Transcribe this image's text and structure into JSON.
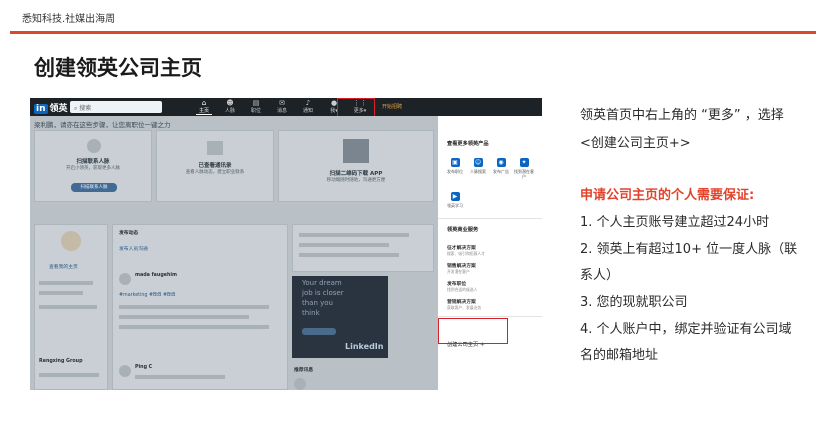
{
  "header": {
    "brand": "悉知科技.社媒出海周"
  },
  "slide": {
    "title": "创建领英公司主页"
  },
  "screenshot": {
    "topbar": {
      "logo": "领英",
      "search_placeholder": "搜索",
      "nav": [
        {
          "label": "主页",
          "icon": "home-icon",
          "glyph": "⌂"
        },
        {
          "label": "人脉",
          "icon": "people-icon",
          "glyph": "☻"
        },
        {
          "label": "职位",
          "icon": "briefcase-icon",
          "glyph": "▤"
        },
        {
          "label": "消息",
          "icon": "message-icon",
          "glyph": "✉"
        },
        {
          "label": "通知",
          "icon": "bell-icon",
          "glyph": "♪"
        },
        {
          "label": "我▾",
          "icon": "avatar-icon",
          "glyph": "●"
        },
        {
          "label": "更多▾",
          "icon": "grid-icon",
          "glyph": "⋮⋮"
        }
      ],
      "recruit": "开始招聘"
    },
    "feed": {
      "tagline": "梁利鹏，请亦在这些步骤，让您离职位一键之力",
      "card1": {
        "title": "扫描联系人脉",
        "sub": "开启小领英，获取更多人脉",
        "button": "扫描联系人脉"
      },
      "card2": {
        "title": "已查看通讯录",
        "sub": "查看人脉动态，建立职业联系"
      },
      "card3": {
        "title": "扫描二维码下载 APP",
        "sub": "移动端随时随地，沟通更方便"
      },
      "profile_link": "查看我的主页",
      "post_title": "发布动态",
      "post_sub": "发布人员沟通",
      "author1": "mada faugehim",
      "hashtag": "#marketing #BtB #BtB",
      "author2": "Ping C",
      "group": "Rengxing Group",
      "news": "推荐讯息",
      "ad_lines": [
        "Your dream",
        "job is closer",
        "than you",
        "think"
      ],
      "ad_logo": "LinkedIn"
    },
    "dropdown": {
      "products_title": "查看更多领英产品",
      "products": [
        {
          "label": "发布职位",
          "icon": "briefcase-icon",
          "color": "#0a66c2",
          "glyph": "▣"
        },
        {
          "label": "人脉搜索",
          "icon": "people-search-icon",
          "color": "#0a66c2",
          "glyph": "☺"
        },
        {
          "label": "发布广告",
          "icon": "ads-icon",
          "color": "#0a66c2",
          "glyph": "◉"
        },
        {
          "label": "找到潜在客户",
          "icon": "compass-icon",
          "color": "#0a66c2",
          "glyph": "✦"
        },
        {
          "label": "领英学习",
          "icon": "learning-icon",
          "color": "#0a66c2",
          "glyph": "▶"
        }
      ],
      "services_title": "领英商业服务",
      "services": [
        {
          "title": "征才解决方案",
          "sub": "搜索、吸引和招募人才"
        },
        {
          "title": "销售解决方案",
          "sub": "开发潜在客户"
        },
        {
          "title": "发布职位",
          "sub": "找到合适的候选人"
        },
        {
          "title": "营销解决方案",
          "sub": "获取客户、发展业务"
        }
      ],
      "create_page": "创建公司主页 ＋"
    }
  },
  "right_panel": {
    "intro": [
      "领英首页中右上角的 “更多” ，选择",
      "<创建公司主页+>"
    ],
    "requirements_title": "申请公司主页的个人需要保证:",
    "items": [
      "1. 个人主页账号建立超过24小时",
      "2. 领英上有超过10+ 位一度人脉（联",
      "系人）",
      "3. 您的现就职公司",
      "4. 个人账户中，绑定并验证有公司域",
      "名的邮箱地址"
    ]
  },
  "colors": {
    "accent_rule": "#d8482a",
    "highlight_red": "#e2432b",
    "linkedin_blue": "#0a66c2"
  }
}
